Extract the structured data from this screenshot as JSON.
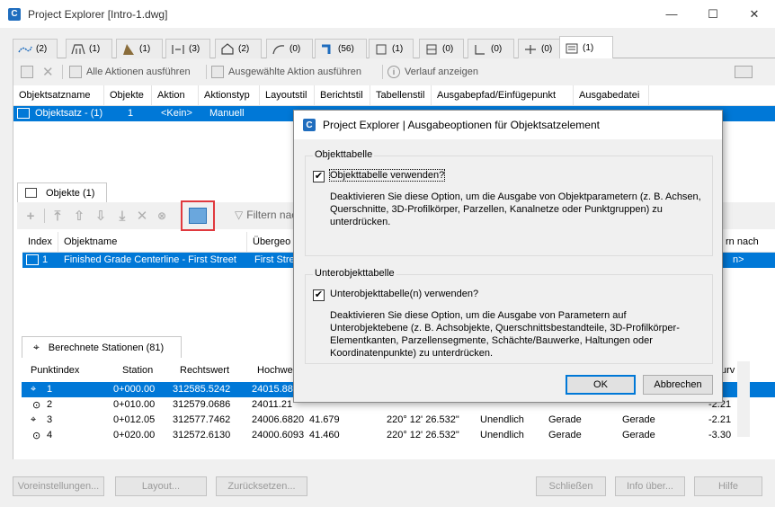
{
  "window": {
    "title": "Project Explorer [Intro-1.dwg]",
    "logo": "C",
    "minimize": "—",
    "maximize": "☐",
    "close": "✕"
  },
  "top_tabs": [
    {
      "icon": "alignment-icon",
      "count": "(2)"
    },
    {
      "icon": "bridge-icon",
      "count": "(1)"
    },
    {
      "icon": "surface-icon",
      "count": "(1)"
    },
    {
      "icon": "corridor-icon",
      "count": "(3)"
    },
    {
      "icon": "parcel-icon",
      "count": "(2)"
    },
    {
      "icon": "featureline-icon",
      "count": "(0)"
    },
    {
      "icon": "pipe-icon",
      "count": "(56)"
    },
    {
      "icon": "structure-icon",
      "count": "(1)"
    },
    {
      "icon": "structure2-icon",
      "count": "(0)"
    },
    {
      "icon": "assembly-icon",
      "count": "(0)"
    },
    {
      "icon": "sample-icon",
      "count": "(0)"
    },
    {
      "icon": "objectset-icon",
      "count": "(1)"
    }
  ],
  "toolbar1": {
    "run_all": "Alle Aktionen ausführen",
    "run_selected": "Ausgewählte Aktion ausführen",
    "history": "Verlauf anzeigen"
  },
  "objectset_table": {
    "headers": [
      "Objektsatzname",
      "Objekte",
      "Aktion",
      "Aktionstyp",
      "Layoutstil",
      "Berichtstil",
      "Tabellenstil",
      "Ausgabepfad/Einfügepunkt",
      "Ausgabedatei"
    ],
    "row": [
      "Objektsatz - (1)",
      "1",
      "<Kein>",
      "Manuell"
    ]
  },
  "objekte_tab": {
    "label": "Objekte (1)",
    "filter": "Filtern nach..."
  },
  "objekte_table": {
    "headers": [
      "Index",
      "Objektname",
      "Übergeo",
      "rn nach"
    ],
    "row": [
      "1",
      "Finished Grade Centerline - First Street",
      "First Stre",
      "n>"
    ]
  },
  "stations_tab": {
    "label": "Berechnete Stationen (81)"
  },
  "stations_table": {
    "headers": [
      "Punktindex",
      "Station",
      "Rechtswert",
      "Hochwe",
      "urv"
    ],
    "rows": [
      [
        "1",
        "0+000.00",
        "312585.5242",
        "24015.88",
        "",
        "",
        "",
        "",
        "",
        "",
        ""
      ],
      [
        "2",
        "0+010.00",
        "312579.0686",
        "24011.21",
        "",
        "",
        "",
        "",
        "",
        "",
        "-2.21"
      ],
      [
        "3",
        "0+012.05",
        "312577.7462",
        "24006.6820",
        "41.679",
        "220° 12' 26.532\"",
        "Unendlich",
        "Gerade",
        "Gerade",
        "-2.21"
      ],
      [
        "4",
        "0+020.00",
        "312572.6130",
        "24000.6093",
        "41.460",
        "220° 12' 26.532\"",
        "Unendlich",
        "Gerade",
        "Gerade",
        "-3.30"
      ]
    ]
  },
  "bottom_buttons": {
    "preferences": "Voreinstellungen...",
    "layout": "Layout...",
    "reset": "Zurücksetzen...",
    "close": "Schließen",
    "info": "Info über...",
    "help": "Hilfe"
  },
  "dialog": {
    "title": "Project Explorer | Ausgabeoptionen für Objektsatzelement",
    "group1": {
      "title": "Objekttabelle",
      "checkbox": "Objekttabelle verwenden?",
      "checked": true,
      "description": "Deaktivieren Sie diese Option, um die Ausgabe von Objektparametern (z. B. Achsen,\nQuerschnitte, 3D-Profilkörper, Parzellen, Kanalnetze oder Punktgruppen) zu\nunterdrücken."
    },
    "group2": {
      "title": "Unterobjekttabelle",
      "checkbox": "Unterobjekttabelle(n) verwenden?",
      "checked": true,
      "description": "Deaktivieren Sie diese Option, um die Ausgabe von Parametern auf\nUnterobjektebene (z. B. Achsobjekte, Querschnittsbestandteile, 3D-Profilkörper-\nElementkanten, Parzellensegmente, Schächte/Bauwerke, Haltungen oder\nKoordinatenpunkte) zu unterdrücken."
    },
    "ok": "OK",
    "cancel": "Abbrechen",
    "check_mark": "✔"
  }
}
